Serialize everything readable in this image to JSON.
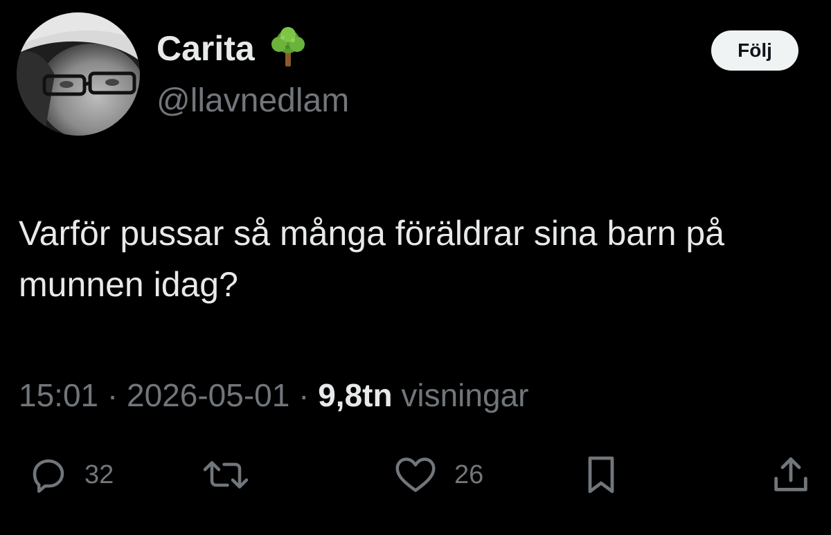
{
  "user": {
    "display_name": "Carita",
    "badge_emoji_icon": "deciduous-tree-icon",
    "handle": "@llavnedlam"
  },
  "follow_button": {
    "label": "Följ"
  },
  "tweet": {
    "text": "Varför pussar så många föräldrar sina barn på munnen idag?"
  },
  "meta": {
    "time": "15:01",
    "separator": "·",
    "date": "2026-05-01",
    "views_count": "9,8tn",
    "views_label": "visningar"
  },
  "actions": {
    "reply": {
      "icon": "reply-icon",
      "count": "32"
    },
    "retweet": {
      "icon": "retweet-icon"
    },
    "like": {
      "icon": "heart-icon",
      "count": "26"
    },
    "bookmark": {
      "icon": "bookmark-icon"
    },
    "share": {
      "icon": "share-icon"
    }
  },
  "colors": {
    "background": "#000000",
    "primary_text": "#e7e9ea",
    "secondary_text": "#71767b",
    "follow_bg": "#eff3f4",
    "follow_text": "#0f1419"
  }
}
